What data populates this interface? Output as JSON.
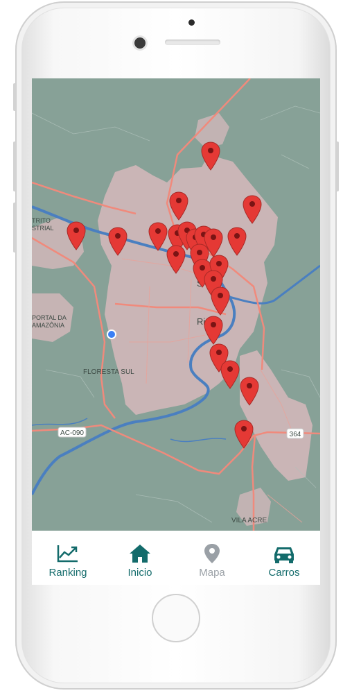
{
  "colors": {
    "accent": "#136b6b",
    "inactive": "#9aa0a6",
    "pin": "#e53935",
    "map_water": "#4a7fc0",
    "map_road": "#f08a7c",
    "map_urban": "#cdb6b7",
    "map_land": "#87a197"
  },
  "map": {
    "labels": {
      "rio_branco": "Rio Br",
      "floresta_sul": "FLORESTA SUL",
      "vila_acre": "VILA ACRE",
      "road_ac090": "AC-090",
      "road_364": "364",
      "distrito_1": "TRITO",
      "distrito_2": "STRIAL",
      "portal_1": "PORTAL DA",
      "portal_2": "AMAZÔNIA",
      "partial_s": "S"
    },
    "marker_icon": "map-pin-icon",
    "user_location_icon": "user-location-dot"
  },
  "nav": {
    "items": [
      {
        "label": "Ranking",
        "icon": "trending-up-icon",
        "active": true
      },
      {
        "label": "Inicio",
        "icon": "home-icon",
        "active": true
      },
      {
        "label": "Mapa",
        "icon": "map-marker-icon",
        "active": false
      },
      {
        "label": "Carros",
        "icon": "car-icon",
        "active": true
      }
    ]
  }
}
